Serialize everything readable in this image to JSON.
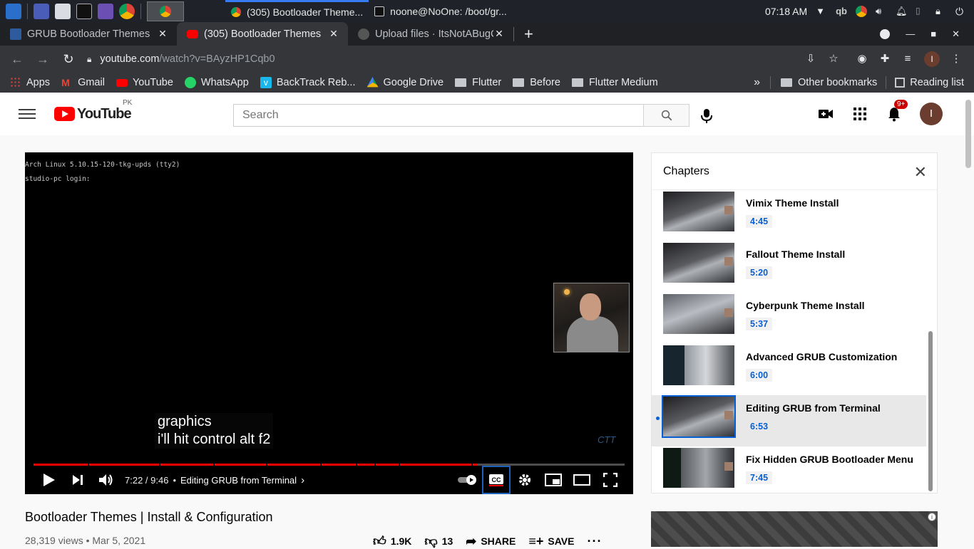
{
  "taskbar": {
    "task1": "(305) Bootloader Theme...",
    "task2": "noone@NoOne: /boot/gr...",
    "clock": "07:18 AM",
    "tray_qb": "qb"
  },
  "tabs": [
    {
      "title": "GRUB Bootloader Themes"
    },
    {
      "title": "(305) Bootloader Themes"
    },
    {
      "title": "Upload files · ItsNotABugC"
    }
  ],
  "address": {
    "host": "youtube.com",
    "path": "/watch?v=BAyzHP1Cqb0"
  },
  "bookmarks": {
    "items": [
      "Apps",
      "Gmail",
      "YouTube",
      "WhatsApp",
      "BackTrack Reb...",
      "Google Drive",
      "Flutter",
      "Before",
      "Flutter Medium"
    ],
    "overflow": "»",
    "other": "Other bookmarks",
    "reading": "Reading list"
  },
  "youtube": {
    "logo_word": "YouTube",
    "country": "PK",
    "search_placeholder": "Search",
    "notif_badge": "9+",
    "avatar_letter": "I"
  },
  "player": {
    "terminal_line1": "Arch Linux 5.10.15-120-tkg-upds (tty2)",
    "terminal_line2": "studio-pc login:",
    "caption_line1": "graphics",
    "caption_line2": "i'll hit control alt f2",
    "time": "7:22 / 9:46",
    "chapter": "Editing GRUB from Terminal",
    "progress_fraction": 0.752,
    "watermark": "CTT"
  },
  "video": {
    "title": "Bootloader Themes | Install & Configuration",
    "meta": "28,319 views • Mar 5, 2021",
    "likes": "1.9K",
    "dislikes": "13",
    "share": "SHARE",
    "save": "SAVE"
  },
  "chapters": {
    "heading": "Chapters",
    "items": [
      {
        "title": "Vimix Theme Install",
        "time": "4:45"
      },
      {
        "title": "Fallout Theme Install",
        "time": "5:20"
      },
      {
        "title": "Cyberpunk Theme Install",
        "time": "5:37"
      },
      {
        "title": "Advanced GRUB Customization",
        "time": "6:00"
      },
      {
        "title": "Editing GRUB from Terminal",
        "time": "6:53"
      },
      {
        "title": "Fix Hidden GRUB Bootloader Menu",
        "time": "7:45"
      }
    ]
  },
  "colors": {
    "yt_red": "#ff0000",
    "link_blue": "#065fd4",
    "browser_dark": "#35363a"
  }
}
